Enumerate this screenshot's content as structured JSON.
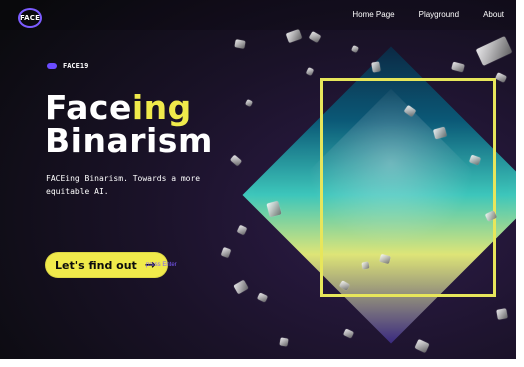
{
  "app": {
    "logo_text": "FACE",
    "nav": {
      "items": [
        {
          "label": "Home Page"
        },
        {
          "label": "Playground"
        },
        {
          "label": "About"
        }
      ]
    }
  },
  "hero": {
    "small_brand": "FACE19",
    "headline": {
      "line1_prefix": "Face",
      "line1_accent": "ing",
      "line2": "Binarism"
    },
    "subtitle": "FACEing Binarism. Towards a more equitable AI.",
    "cta": {
      "label": "Let's find out",
      "arrow": "→",
      "hint": "press Enter"
    }
  },
  "colors": {
    "accent_yellow": "#f0ea4b",
    "accent_purple": "#7c5cff",
    "background_dark": "#0b0b0f"
  },
  "icons": {
    "logo": "face-logo-icon",
    "cta_arrow": "arrow-right-icon"
  }
}
